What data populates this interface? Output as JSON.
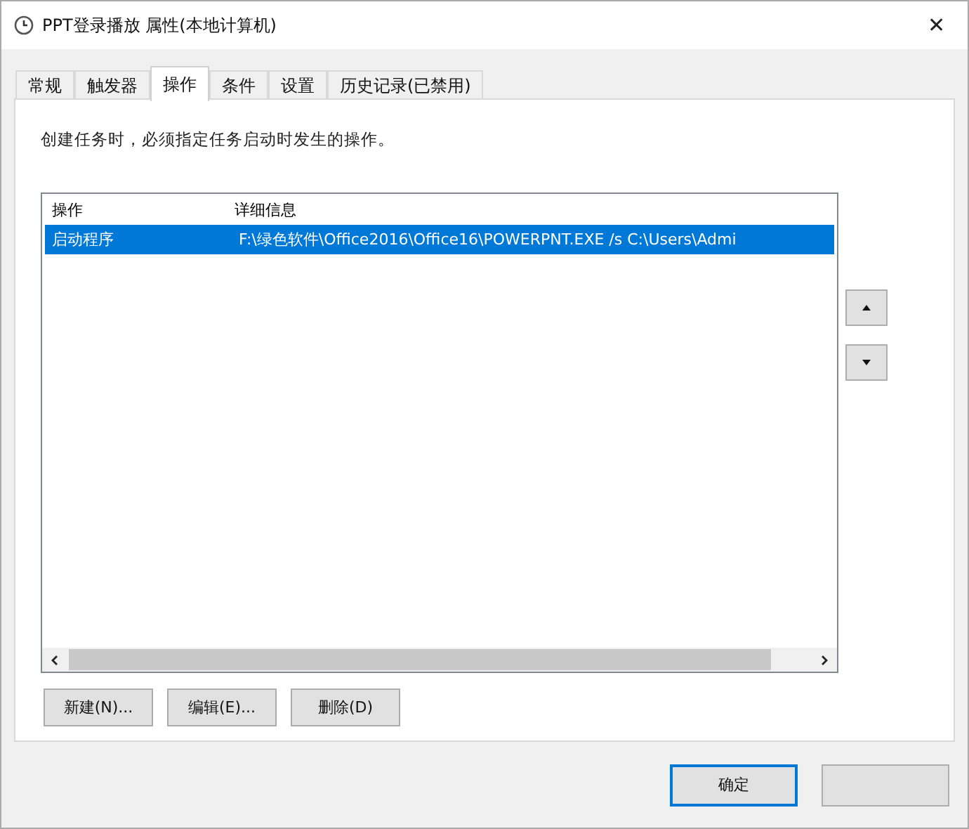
{
  "window": {
    "title": "PPT登录播放 属性(本地计算机)",
    "close": "✕"
  },
  "tabs": [
    {
      "label": "常规",
      "selected": false
    },
    {
      "label": "触发器",
      "selected": false
    },
    {
      "label": "操作",
      "selected": true
    },
    {
      "label": "条件",
      "selected": false
    },
    {
      "label": "设置",
      "selected": false
    },
    {
      "label": "历史记录(已禁用)",
      "selected": false
    }
  ],
  "description": "创建任务时，必须指定任务启动时发生的操作。",
  "table": {
    "columns": [
      "操作",
      "详细信息"
    ],
    "rows": [
      {
        "cells": [
          "启动程序",
          "F:\\绿色软件\\Office2016\\Office16\\POWERPNT.EXE /s C:\\Users\\Admi"
        ],
        "selected": true
      }
    ]
  },
  "action_buttons": [
    "新建(N)...",
    "编辑(E)...",
    "删除(D)"
  ],
  "footer_buttons": [
    {
      "label": "确定",
      "kind": "default"
    }
  ]
}
